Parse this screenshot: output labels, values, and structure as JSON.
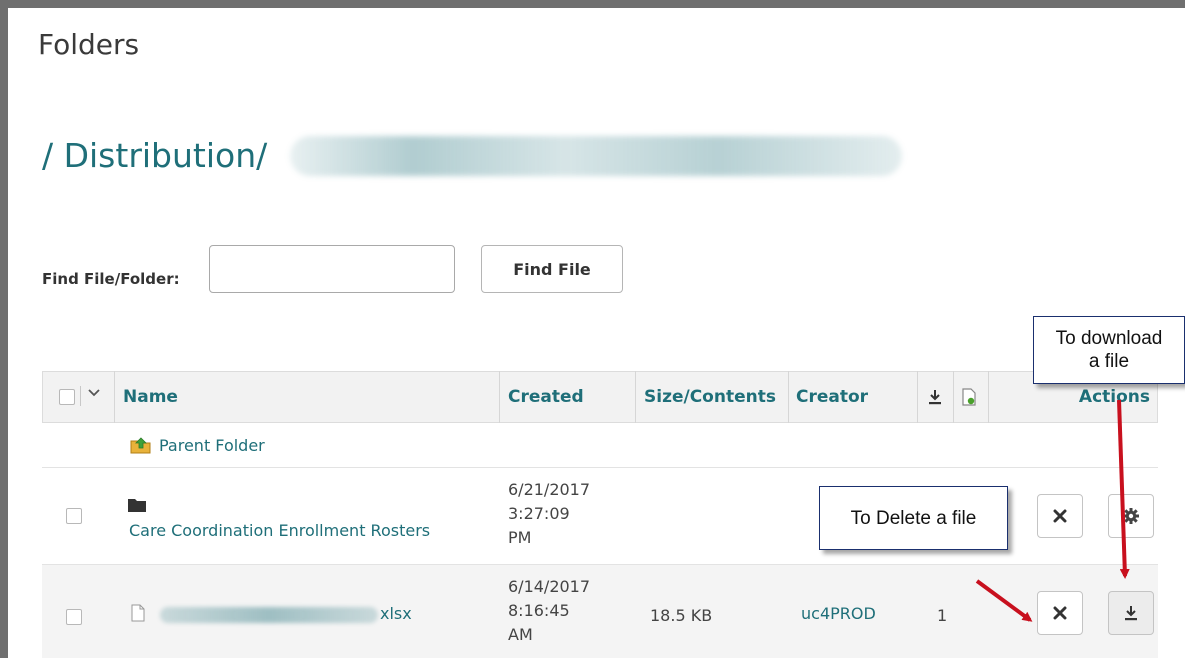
{
  "page": {
    "title": "Folders"
  },
  "path": {
    "text": "/ Distribution/"
  },
  "search": {
    "label": "Find File/Folder:",
    "value": "",
    "placeholder": "",
    "button": "Find File"
  },
  "table": {
    "headers": {
      "name": "Name",
      "created": "Created",
      "size": "Size/Contents",
      "creator": "Creator",
      "actions": "Actions"
    },
    "parent": "Parent Folder",
    "rows": [
      {
        "name": "Care Coordination Enrollment Rosters",
        "created": [
          "6/21/2017",
          "3:27:09",
          "PM"
        ],
        "size": "",
        "creator": "",
        "count": ""
      },
      {
        "name": "xlsx",
        "created": [
          "6/14/2017",
          "8:16:45",
          "AM"
        ],
        "size": "18.5 KB",
        "creator": "uc4PROD",
        "count": "1"
      }
    ]
  },
  "callouts": {
    "download": [
      "To download",
      "a file"
    ],
    "delete": "To Delete a file"
  },
  "icons": [
    "checkbox",
    "chevron-down-icon",
    "download-icon",
    "file-check-icon",
    "parent-folder-icon",
    "folder-icon",
    "file-icon",
    "close-icon",
    "gear-icon",
    "arrow-icon"
  ],
  "colors": {
    "link": "#1f6f79",
    "arrow": "#c8101e",
    "callout_border": "#1a2f6e"
  }
}
